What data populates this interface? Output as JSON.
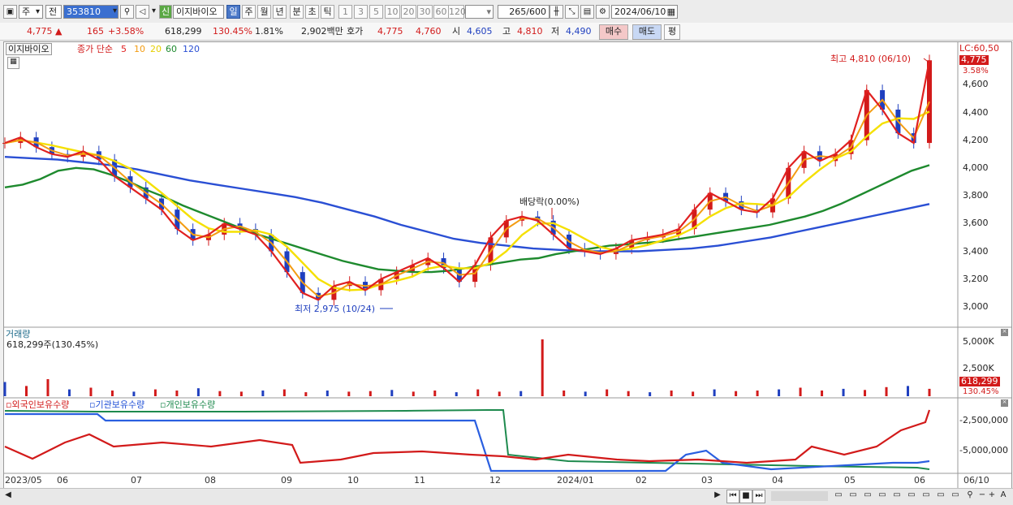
{
  "toolbar": {
    "market": "주",
    "prev_label": "전",
    "code": "353810",
    "badge": "신",
    "name": "이지바이오",
    "periods": [
      "일",
      "주",
      "월",
      "년",
      "분",
      "초",
      "틱"
    ],
    "active_period": "일",
    "intervals": [
      "1",
      "3",
      "5",
      "10",
      "20",
      "30",
      "60",
      "120"
    ],
    "count_value": "265",
    "count_max": "/600",
    "date": "2024/06/10"
  },
  "quote": {
    "price": "4,775",
    "change_arrow": "▲",
    "change": "165",
    "change_rate": "+3.58%",
    "volume": "618,299",
    "volume_rate": "130.45%",
    "turnover": "1.81%",
    "amount": "2,902백만",
    "ask_label": "호가",
    "ask": "4,775",
    "bid": "4,760",
    "open_label": "시",
    "open": "4,605",
    "high_label": "고",
    "high": "4,810",
    "low_label": "저",
    "low": "4,490",
    "buy_label": "매수",
    "sell_label": "매도",
    "avg_label": "평"
  },
  "legend": {
    "name": "이지바이오",
    "ma_prefix": "종가 단순",
    "ma": [
      {
        "label": "5",
        "color": "#e02020"
      },
      {
        "label": "10",
        "color": "#f39c12"
      },
      {
        "label": "20",
        "color": "#f5e000"
      },
      {
        "label": "60",
        "color": "#1e8a2e"
      },
      {
        "label": "120",
        "color": "#2a4fd4"
      }
    ]
  },
  "annotations": {
    "high": "최고 4,810 (06/10)",
    "low": "최저 2,975 (10/24)",
    "dividend": "배당락(0.00%)"
  },
  "right_axis": {
    "lc": "LC:60,50",
    "price_tag": "4,775",
    "rate_tag": "3.58%",
    "price_ticks": [
      "4,600",
      "4,400",
      "4,200",
      "4,000",
      "3,800",
      "3,600",
      "3,400",
      "3,200",
      "3,000"
    ],
    "volume_ticks": [
      "5,000K",
      "2,500K"
    ],
    "volume_tag": "618,299",
    "volume_rate_tag": "130.45%",
    "holding_ticks": [
      "-2,500,000",
      "-5,000,000"
    ]
  },
  "volume_panel": {
    "title": "거래량",
    "value": "618,299주(130.45%)"
  },
  "holding_panel": {
    "items": [
      {
        "label": "외국인보유수량",
        "color": "#d21a1a"
      },
      {
        "label": "기관보유수량",
        "color": "#1f4fd6"
      },
      {
        "label": "개인보유수량",
        "color": "#1e8a4e"
      }
    ]
  },
  "x_axis": [
    "2023/05",
    "06",
    "07",
    "08",
    "09",
    "10",
    "11",
    "12",
    "2024/01",
    "02",
    "03",
    "04",
    "05",
    "06",
    "06/10"
  ],
  "chart_data": {
    "type": "line",
    "title": "",
    "ylim": [
      2900,
      4800
    ],
    "close": [
      4180,
      4220,
      4150,
      4100,
      4080,
      4120,
      4060,
      3940,
      3860,
      3780,
      3700,
      3560,
      3480,
      3520,
      3600,
      3560,
      3520,
      3400,
      3250,
      3100,
      3050,
      3150,
      3180,
      3120,
      3200,
      3250,
      3300,
      3350,
      3280,
      3180,
      3300,
      3500,
      3620,
      3650,
      3620,
      3520,
      3420,
      3400,
      3380,
      3420,
      3480,
      3500,
      3520,
      3560,
      3700,
      3820,
      3760,
      3700,
      3680,
      3780,
      4000,
      4120,
      4050,
      4100,
      4200,
      4560,
      4420,
      4250,
      4180,
      4775
    ],
    "ma60": [
      3860,
      3880,
      3920,
      3980,
      4000,
      3990,
      3950,
      3900,
      3840,
      3790,
      3730,
      3680,
      3630,
      3580,
      3530,
      3490,
      3450,
      3410,
      3370,
      3330,
      3300,
      3270,
      3260,
      3250,
      3250,
      3260,
      3280,
      3300,
      3320,
      3340,
      3350,
      3380,
      3400,
      3420,
      3440,
      3450,
      3460,
      3470,
      3490,
      3510,
      3530,
      3550,
      3570,
      3590,
      3620,
      3650,
      3690,
      3740,
      3800,
      3860,
      3920,
      3980,
      4020
    ],
    "ma120": [
      4080,
      4070,
      4060,
      4040,
      4020,
      3990,
      3950,
      3910,
      3880,
      3850,
      3820,
      3790,
      3750,
      3700,
      3650,
      3590,
      3540,
      3490,
      3460,
      3440,
      3420,
      3410,
      3400,
      3400,
      3400,
      3410,
      3420,
      3440,
      3470,
      3500,
      3540,
      3580,
      3620,
      3660,
      3700,
      3740
    ],
    "volume_ratio": [
      0.25,
      0.18,
      0.3,
      0.12,
      0.15,
      0.1,
      0.08,
      0.12,
      0.1,
      0.14,
      0.09,
      0.08,
      0.1,
      0.12,
      0.07,
      0.1,
      0.08,
      0.09,
      0.11,
      0.08,
      0.1,
      0.07,
      0.12,
      0.08,
      0.09,
      1.0,
      0.1,
      0.08,
      0.12,
      0.09,
      0.07,
      0.1,
      0.08,
      0.12,
      0.09,
      0.1,
      0.12,
      0.15,
      0.1,
      0.13,
      0.11,
      0.16,
      0.18,
      0.13
    ]
  }
}
